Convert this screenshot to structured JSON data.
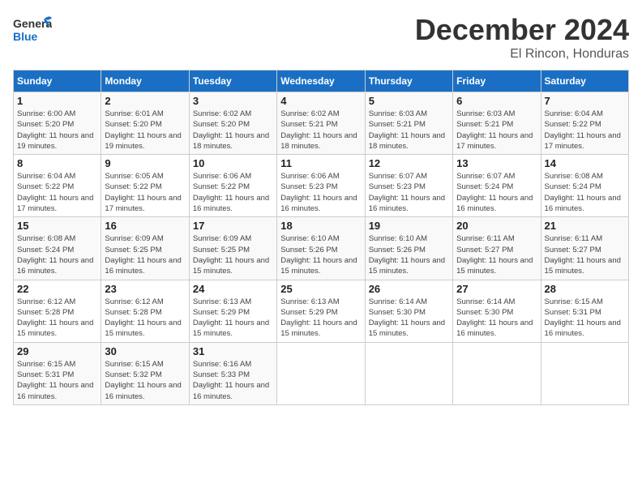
{
  "header": {
    "logo_general": "General",
    "logo_blue": "Blue",
    "title": "December 2024",
    "location": "El Rincon, Honduras"
  },
  "weekdays": [
    "Sunday",
    "Monday",
    "Tuesday",
    "Wednesday",
    "Thursday",
    "Friday",
    "Saturday"
  ],
  "weeks": [
    [
      {
        "day": "1",
        "info": "Sunrise: 6:00 AM\nSunset: 5:20 PM\nDaylight: 11 hours and 19 minutes."
      },
      {
        "day": "2",
        "info": "Sunrise: 6:01 AM\nSunset: 5:20 PM\nDaylight: 11 hours and 19 minutes."
      },
      {
        "day": "3",
        "info": "Sunrise: 6:02 AM\nSunset: 5:20 PM\nDaylight: 11 hours and 18 minutes."
      },
      {
        "day": "4",
        "info": "Sunrise: 6:02 AM\nSunset: 5:21 PM\nDaylight: 11 hours and 18 minutes."
      },
      {
        "day": "5",
        "info": "Sunrise: 6:03 AM\nSunset: 5:21 PM\nDaylight: 11 hours and 18 minutes."
      },
      {
        "day": "6",
        "info": "Sunrise: 6:03 AM\nSunset: 5:21 PM\nDaylight: 11 hours and 17 minutes."
      },
      {
        "day": "7",
        "info": "Sunrise: 6:04 AM\nSunset: 5:22 PM\nDaylight: 11 hours and 17 minutes."
      }
    ],
    [
      {
        "day": "8",
        "info": "Sunrise: 6:04 AM\nSunset: 5:22 PM\nDaylight: 11 hours and 17 minutes."
      },
      {
        "day": "9",
        "info": "Sunrise: 6:05 AM\nSunset: 5:22 PM\nDaylight: 11 hours and 17 minutes."
      },
      {
        "day": "10",
        "info": "Sunrise: 6:06 AM\nSunset: 5:22 PM\nDaylight: 11 hours and 16 minutes."
      },
      {
        "day": "11",
        "info": "Sunrise: 6:06 AM\nSunset: 5:23 PM\nDaylight: 11 hours and 16 minutes."
      },
      {
        "day": "12",
        "info": "Sunrise: 6:07 AM\nSunset: 5:23 PM\nDaylight: 11 hours and 16 minutes."
      },
      {
        "day": "13",
        "info": "Sunrise: 6:07 AM\nSunset: 5:24 PM\nDaylight: 11 hours and 16 minutes."
      },
      {
        "day": "14",
        "info": "Sunrise: 6:08 AM\nSunset: 5:24 PM\nDaylight: 11 hours and 16 minutes."
      }
    ],
    [
      {
        "day": "15",
        "info": "Sunrise: 6:08 AM\nSunset: 5:24 PM\nDaylight: 11 hours and 16 minutes."
      },
      {
        "day": "16",
        "info": "Sunrise: 6:09 AM\nSunset: 5:25 PM\nDaylight: 11 hours and 16 minutes."
      },
      {
        "day": "17",
        "info": "Sunrise: 6:09 AM\nSunset: 5:25 PM\nDaylight: 11 hours and 15 minutes."
      },
      {
        "day": "18",
        "info": "Sunrise: 6:10 AM\nSunset: 5:26 PM\nDaylight: 11 hours and 15 minutes."
      },
      {
        "day": "19",
        "info": "Sunrise: 6:10 AM\nSunset: 5:26 PM\nDaylight: 11 hours and 15 minutes."
      },
      {
        "day": "20",
        "info": "Sunrise: 6:11 AM\nSunset: 5:27 PM\nDaylight: 11 hours and 15 minutes."
      },
      {
        "day": "21",
        "info": "Sunrise: 6:11 AM\nSunset: 5:27 PM\nDaylight: 11 hours and 15 minutes."
      }
    ],
    [
      {
        "day": "22",
        "info": "Sunrise: 6:12 AM\nSunset: 5:28 PM\nDaylight: 11 hours and 15 minutes."
      },
      {
        "day": "23",
        "info": "Sunrise: 6:12 AM\nSunset: 5:28 PM\nDaylight: 11 hours and 15 minutes."
      },
      {
        "day": "24",
        "info": "Sunrise: 6:13 AM\nSunset: 5:29 PM\nDaylight: 11 hours and 15 minutes."
      },
      {
        "day": "25",
        "info": "Sunrise: 6:13 AM\nSunset: 5:29 PM\nDaylight: 11 hours and 15 minutes."
      },
      {
        "day": "26",
        "info": "Sunrise: 6:14 AM\nSunset: 5:30 PM\nDaylight: 11 hours and 15 minutes."
      },
      {
        "day": "27",
        "info": "Sunrise: 6:14 AM\nSunset: 5:30 PM\nDaylight: 11 hours and 16 minutes."
      },
      {
        "day": "28",
        "info": "Sunrise: 6:15 AM\nSunset: 5:31 PM\nDaylight: 11 hours and 16 minutes."
      }
    ],
    [
      {
        "day": "29",
        "info": "Sunrise: 6:15 AM\nSunset: 5:31 PM\nDaylight: 11 hours and 16 minutes."
      },
      {
        "day": "30",
        "info": "Sunrise: 6:15 AM\nSunset: 5:32 PM\nDaylight: 11 hours and 16 minutes."
      },
      {
        "day": "31",
        "info": "Sunrise: 6:16 AM\nSunset: 5:33 PM\nDaylight: 11 hours and 16 minutes."
      },
      null,
      null,
      null,
      null
    ]
  ]
}
